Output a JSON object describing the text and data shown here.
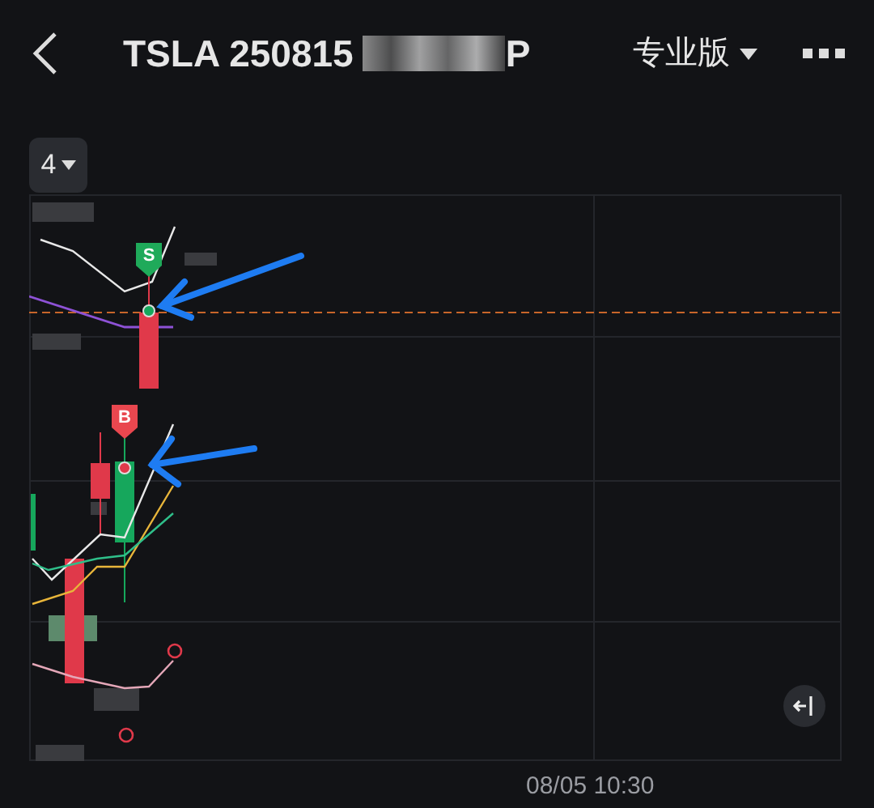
{
  "header": {
    "title": "TSLA 250815",
    "title_suffix": "P",
    "edition": "专业版"
  },
  "period": {
    "value": "4"
  },
  "chart": {
    "markers": [
      {
        "kind": "sell",
        "label": "S"
      },
      {
        "kind": "buy",
        "label": "B"
      }
    ]
  },
  "time_axis": {
    "label": "08/05 10:30"
  }
}
